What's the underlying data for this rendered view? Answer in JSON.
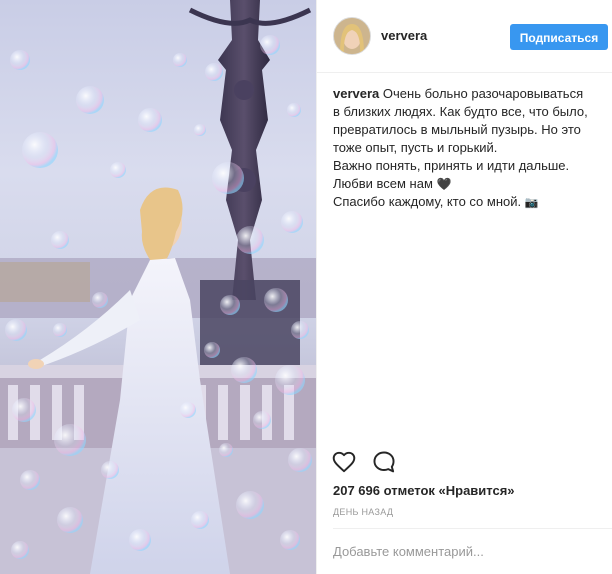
{
  "post": {
    "username": "ververa",
    "follow_label": "Подписаться",
    "caption": {
      "username": "ververa",
      "first_line": "Очень больно разочаровываться",
      "lines": [
        "в близких людях. Как будто все, что было,",
        "превратилось в мыльный пузырь. Но это",
        "тоже опыт, пусть и горький.",
        "Важно понять, принять и идти дальше.",
        "Любви всем нам",
        "Спасибо каждому, кто со мной."
      ],
      "heart_emoji": "🖤",
      "camera_emoji": "📷"
    },
    "likes_text": "207 696 отметок «Нравится»",
    "timestamp": "День назад",
    "comment_placeholder": "Добавьте комментарий..."
  },
  "colors": {
    "follow_button": "#3897f0",
    "text": "#262626",
    "muted": "#999999",
    "divider": "#efefef"
  },
  "icons": {
    "like": "heart-outline-icon",
    "comment": "speech-bubble-icon"
  }
}
